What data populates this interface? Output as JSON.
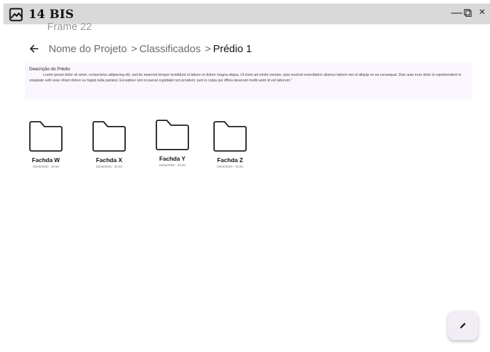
{
  "app": {
    "title": "14 BIS",
    "frame_label": "Frame 22"
  },
  "window_controls": {
    "minimize": "—",
    "restore": "⧉",
    "close": "×"
  },
  "breadcrumb": {
    "items": [
      "Nome do Projeto",
      "Classificados"
    ],
    "separator": ">",
    "current": "Prédio 1"
  },
  "description": {
    "title": "Deacrição do Prédio",
    "text": "Lorem ipsum dolor sit amet, consectetur adipiscing elit, sed do eiusmod tempor incididunt ut labore et dolore magna aliqua. Ut enim ad minim veniam, quis nostrud exercitation ullamco laboris nisi ut aliquip ex ea consequat. Duis aute irure dolor in reprehenderit in voluptate velit esse cillum dolore eu fugiat nulla pariatur. Excepteur sint occaecat cupidatat non proident, sunt in culpa qui officia deserunt mollit anim id est laborum.\""
  },
  "folders": [
    {
      "name": "Fachda W",
      "date": "00/00/0000 - 00:00"
    },
    {
      "name": "Fachda X",
      "date": "00/00/0000 - 00:00"
    },
    {
      "name": "Fachda Y",
      "date": "00/00/0000 - 00:00"
    },
    {
      "name": "Fachda Z",
      "date": "00/00/0000 - 00:00"
    }
  ],
  "icons": {
    "app": "image-icon",
    "back": "arrow-left-icon",
    "folder": "folder-icon",
    "fab": "pencil-icon"
  }
}
